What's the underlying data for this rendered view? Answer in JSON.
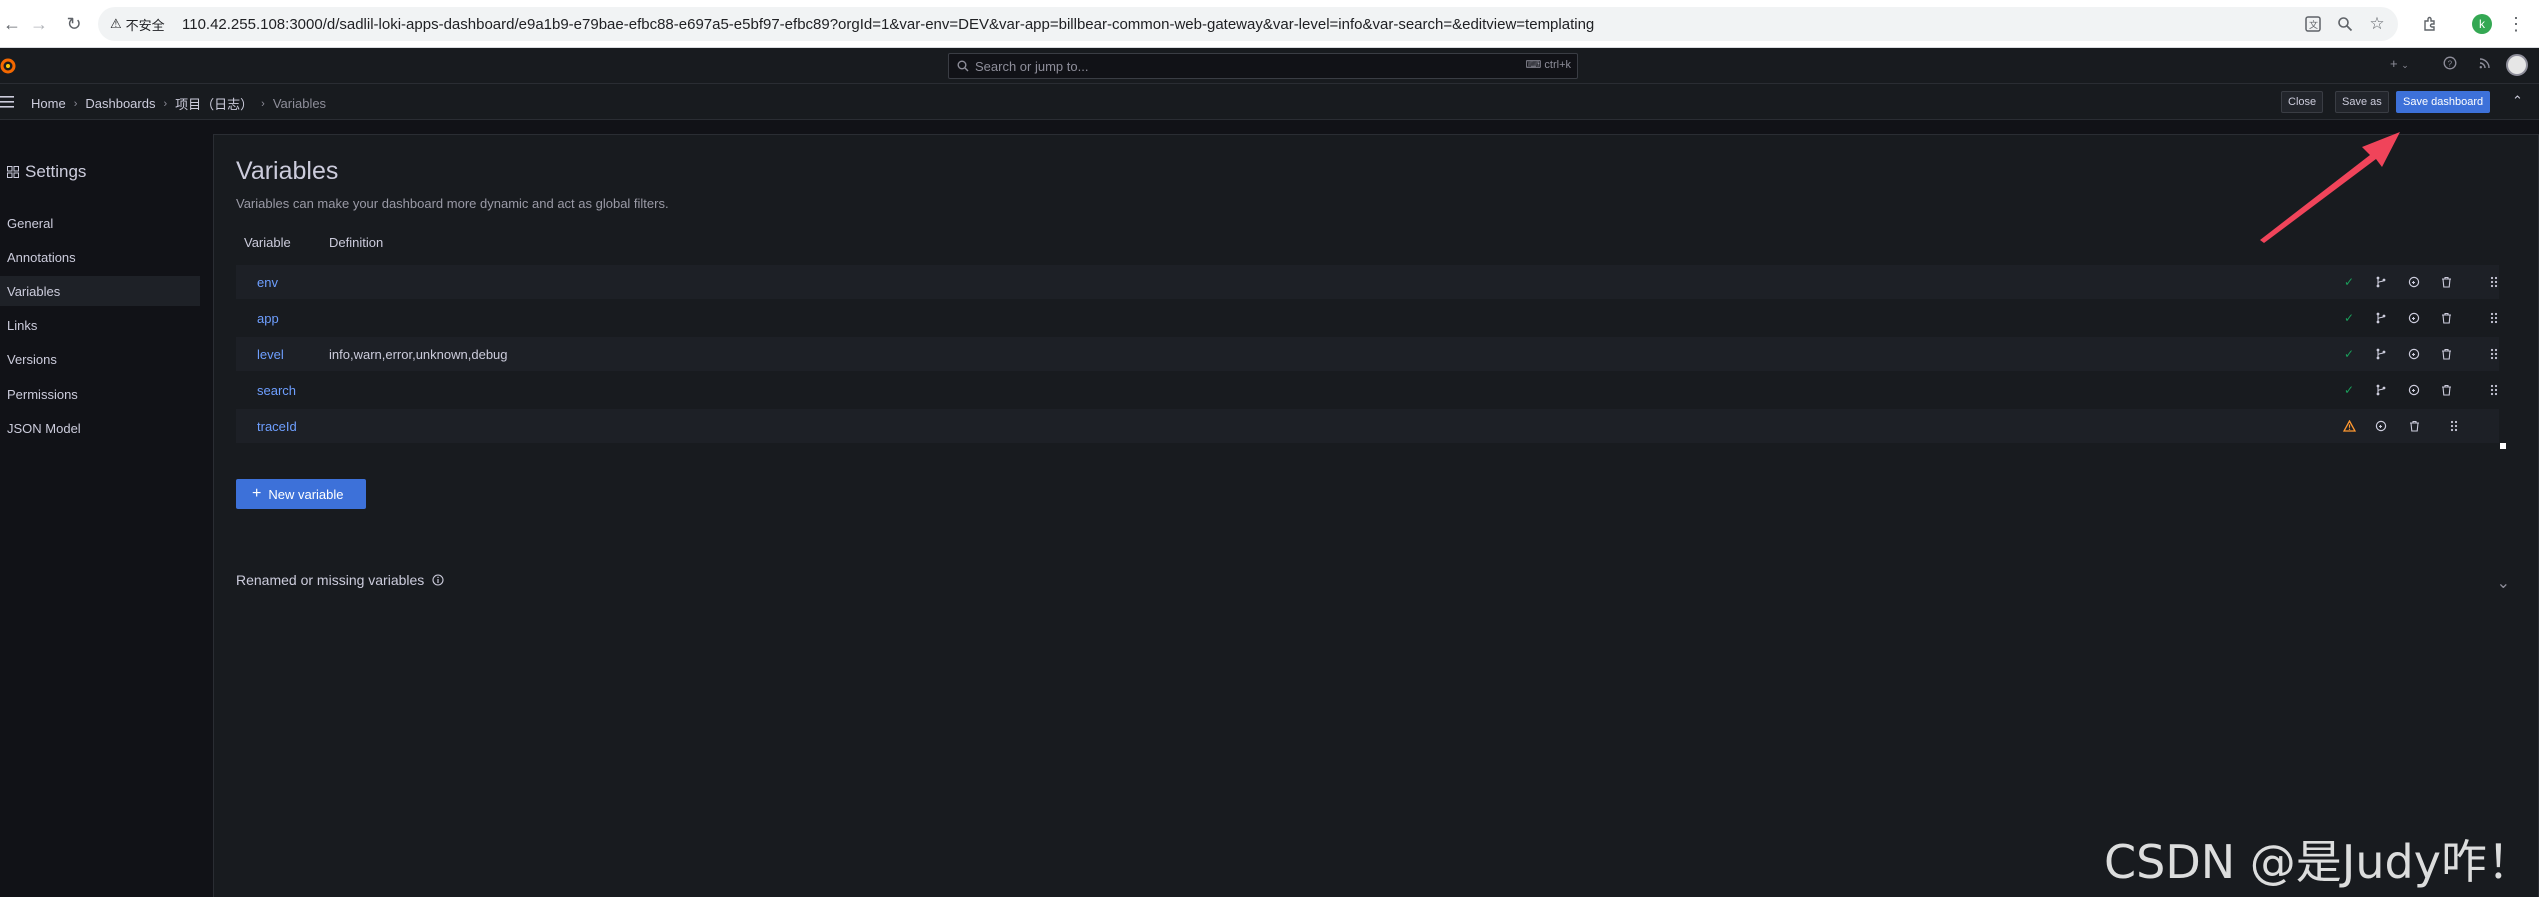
{
  "browser": {
    "insecure_label": "不安全",
    "url": "110.42.255.108:3000/d/sadlil-loki-apps-dashboard/e9a1b9-e79bae-efbc88-e697a5-e5bf97-efbc89?orgId=1&var-env=DEV&var-app=billbear-common-web-gateway&var-level=info&var-search=&editview=templating",
    "profile_initial": "k"
  },
  "topbar": {
    "search_placeholder": "Search or jump to...",
    "shortcut": "ctrl+k",
    "add_label": "+"
  },
  "breadcrumb": {
    "items": [
      "Home",
      "Dashboards",
      "项目（日志）",
      "Variables"
    ]
  },
  "header_buttons": {
    "close": "Close",
    "save_as": "Save as",
    "save_dashboard": "Save dashboard"
  },
  "sidebar": {
    "title": "Settings",
    "items": [
      "General",
      "Annotations",
      "Variables",
      "Links",
      "Versions",
      "Permissions",
      "JSON Model"
    ],
    "active": "Variables"
  },
  "main": {
    "title": "Variables",
    "subtitle": "Variables can make your dashboard more dynamic and act as global filters.",
    "columns": [
      "Variable",
      "Definition"
    ],
    "variables": [
      {
        "name": "env",
        "definition": "",
        "status": "ok"
      },
      {
        "name": "app",
        "definition": "",
        "status": "ok"
      },
      {
        "name": "level",
        "definition": "info,warn,error,unknown,debug",
        "status": "ok"
      },
      {
        "name": "search",
        "definition": "",
        "status": "ok"
      },
      {
        "name": "traceId",
        "definition": "",
        "status": "warning"
      }
    ],
    "new_variable": "New variable",
    "renamed_missing": "Renamed or missing variables"
  },
  "watermark": "CSDN @是Judy咋！",
  "colors": {
    "accent": "#3d71d9",
    "link": "#6e9fff",
    "ok": "#1a9d5a",
    "warning": "#ff9830",
    "arrow": "#f0445a"
  }
}
